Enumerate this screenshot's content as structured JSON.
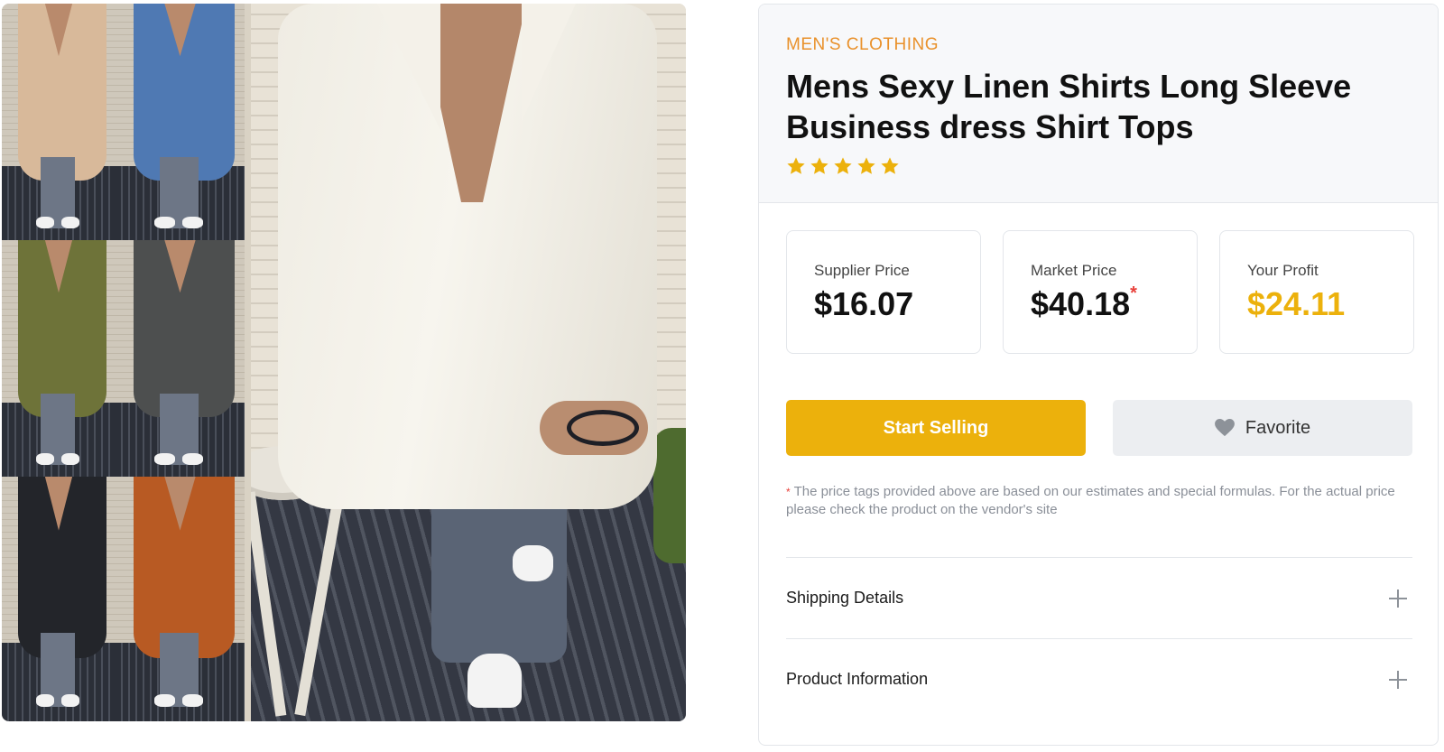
{
  "product": {
    "category": "MEN'S CLOTHING",
    "title": "Mens Sexy Linen Shirts Long Sleeve Business dress Shirt Tops",
    "rating_stars": 5,
    "star_color": "#ecb10c"
  },
  "gallery": {
    "variant_colors": [
      "#d8b99a",
      "#4f79b3",
      "#6e7339",
      "#4d4f4f",
      "#23252a",
      "#b85a23"
    ],
    "main_color": "#f2efe6"
  },
  "prices": [
    {
      "label": "Supplier Price",
      "value": "$16.07"
    },
    {
      "label": "Market Price",
      "value": "$40.18",
      "marker": "*"
    },
    {
      "label": "Your Profit",
      "value": "$24.11"
    }
  ],
  "actions": {
    "start_selling": "Start Selling",
    "favorite": "Favorite",
    "heart_icon": "heart-icon"
  },
  "disclaimer": {
    "marker": "*",
    "text": "The price tags provided above are based on our estimates and special formulas. For the actual price please check the product on the vendor's site"
  },
  "accordion": [
    {
      "label": "Shipping Details",
      "icon": "plus-icon"
    },
    {
      "label": "Product Information",
      "icon": "plus-icon"
    }
  ],
  "colors": {
    "accent": "#ecb10c",
    "category": "#e9912b",
    "asterisk": "#e8403a"
  }
}
